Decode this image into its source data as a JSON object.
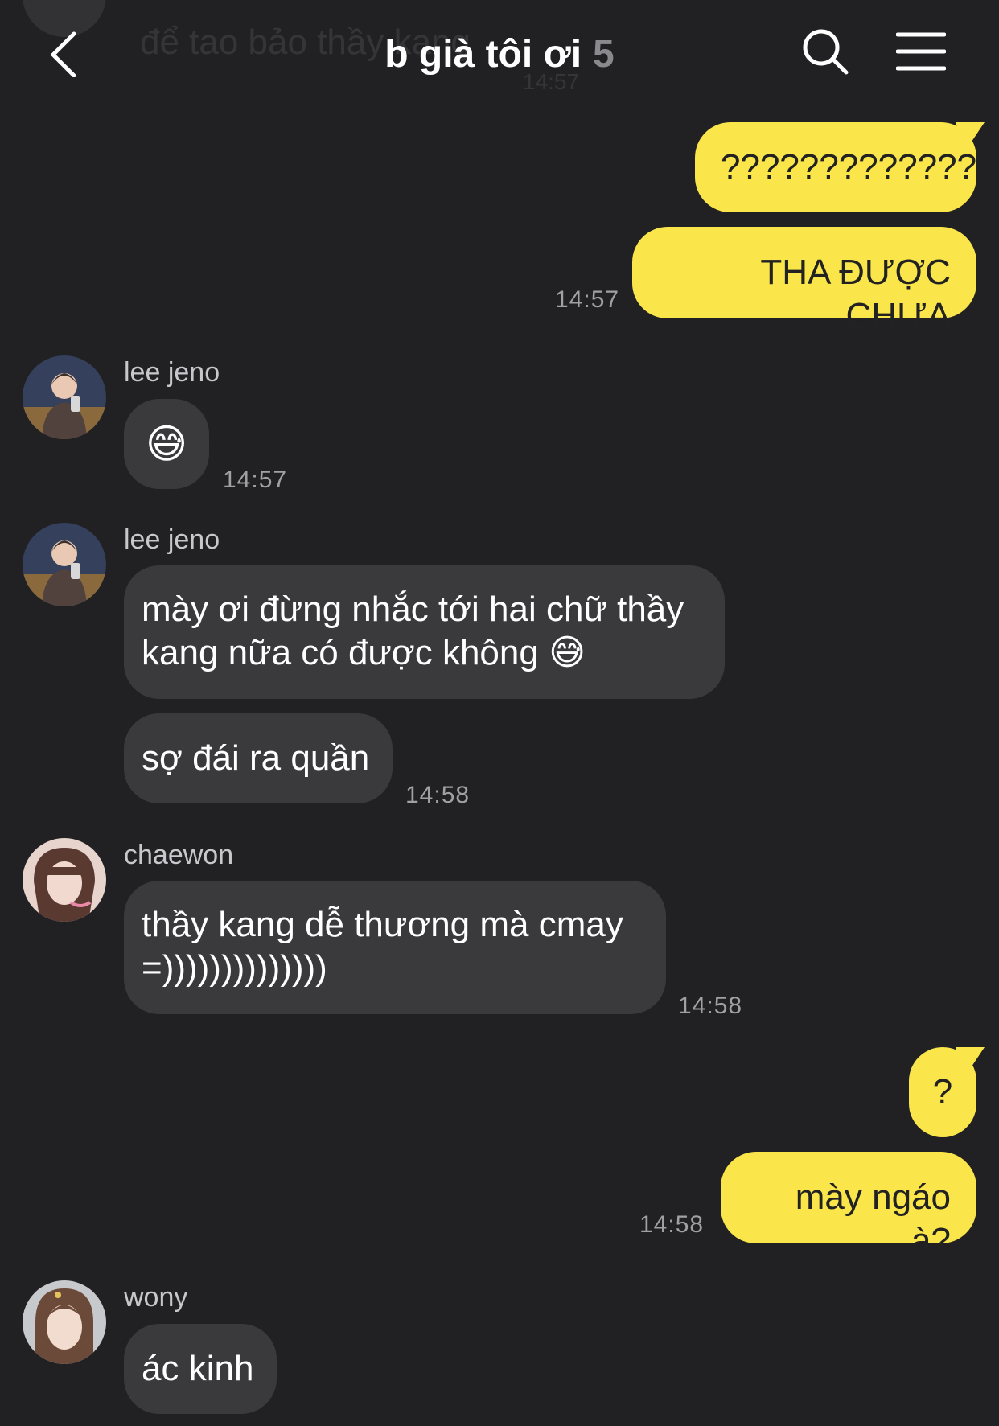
{
  "header": {
    "title": "b già tôi ơi",
    "member_count": "5",
    "ghost_text": "để tao bảo thầy kang",
    "ghost_time": "14:57"
  },
  "messages": {
    "m1": {
      "text": "?????????????"
    },
    "m2": {
      "text": "THA ĐƯỢC CHƯA",
      "time": "14:57"
    },
    "m3": {
      "sender": "lee jeno",
      "emoji": "😅",
      "time": "14:57"
    },
    "m4": {
      "sender": "lee jeno",
      "line1": "mày ơi đừng nhắc tới hai chữ thầy",
      "line2": "kang nữa có được không 😅"
    },
    "m5": {
      "text": "sợ đái ra quần",
      "time": "14:58"
    },
    "m6": {
      "sender": "chaewon",
      "line1": "thầy kang dễ thương mà cmay",
      "line2": "=))))))))))))))",
      "time": "14:58"
    },
    "m7": {
      "text": "?"
    },
    "m8": {
      "text": "mày ngáo à?",
      "time": "14:58"
    },
    "m9": {
      "sender": "wony",
      "text": "ác kinh"
    }
  },
  "colors": {
    "background": "#212124",
    "my_bubble": "#fae64a",
    "their_bubble": "#3a3a3d"
  }
}
